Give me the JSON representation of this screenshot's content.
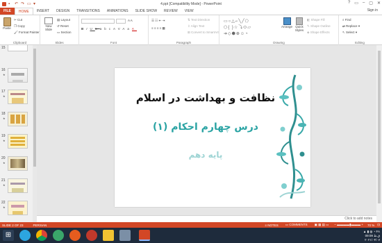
{
  "window": {
    "title": "4.ppt [Compatibility Mode] - PowerPoint",
    "controls": [
      "?",
      "▭",
      "–",
      "▢",
      "✕"
    ]
  },
  "tabs": [
    "FILE",
    "HOME",
    "INSERT",
    "DESIGN",
    "TRANSITIONS",
    "ANIMATIONS",
    "SLIDE SHOW",
    "REVIEW",
    "VIEW"
  ],
  "active_tab": "HOME",
  "sign_in": "Sign in",
  "ribbon": {
    "clipboard": {
      "label": "Clipboard",
      "paste": "Paste",
      "cut": "Cut",
      "copy": "Copy",
      "format_painter": "Format Painter"
    },
    "slides": {
      "label": "Slides",
      "new_slide": "New Slide",
      "layout": "Layout",
      "reset": "Reset",
      "section": "Section"
    },
    "font": {
      "label": "Font",
      "font_name": "",
      "font_size": "",
      "format_buttons": [
        "B",
        "I",
        "U",
        "S",
        "abc",
        "AV",
        "Aa",
        "A"
      ]
    },
    "paragraph": {
      "label": "Paragraph",
      "text_direction": "Text Direction",
      "align_text": "Align Text",
      "convert_smartart": "Convert to SmartArt"
    },
    "drawing": {
      "label": "Drawing",
      "arrange": "Arrange",
      "quick_styles": "Quick Styles",
      "shape_fill": "Shape Fill",
      "shape_outline": "Shape Outline",
      "shape_effects": "Shape Effects"
    },
    "editing": {
      "label": "Editing",
      "find": "Find",
      "replace": "Replace",
      "select": "Select"
    }
  },
  "thumbnails": [
    {
      "num": "15"
    },
    {
      "num": "16"
    },
    {
      "num": "17"
    },
    {
      "num": "18"
    },
    {
      "num": "19"
    },
    {
      "num": "20"
    },
    {
      "num": "21"
    },
    {
      "num": "22"
    }
  ],
  "slide": {
    "title": "نظافت و بهداشت در اسلام",
    "subtitle": "درس چهارم احکام (۱)",
    "grade": "پایه دهم"
  },
  "notes_placeholder": "Click to add notes",
  "status": {
    "slide_of": "SLIDE 2 OF 23",
    "language": "PERSIAN",
    "notes": "NOTES",
    "comments": "COMMENTS",
    "zoom": "70 %"
  },
  "taskbar": {
    "time": "09:09 ق.ظ",
    "date": "۲۰۲۱/۰۴/۰۷",
    "lang": "FA"
  },
  "colors": {
    "accent": "#d24726",
    "teal": "#29a3a3",
    "taskbar": "#1e2b3c"
  }
}
